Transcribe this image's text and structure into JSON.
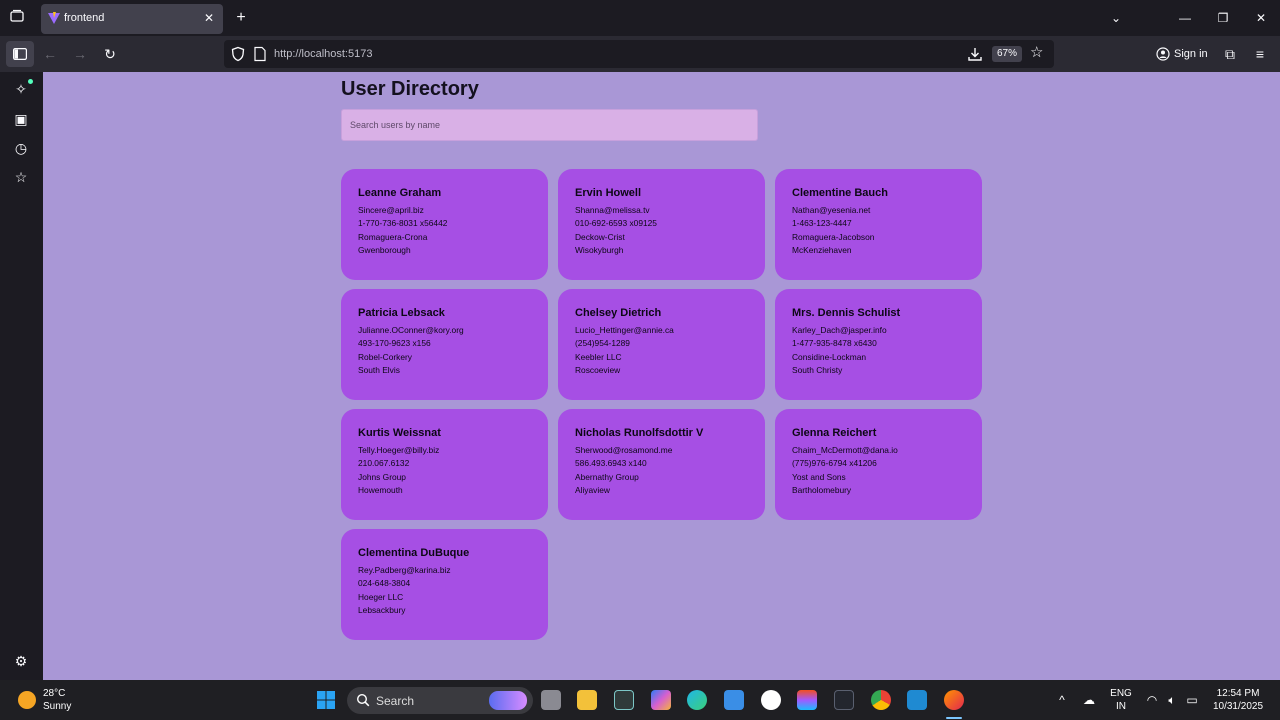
{
  "browser": {
    "tab_title": "frontend",
    "url": "http://localhost:5173",
    "zoom": "67%",
    "sign_in": "Sign in"
  },
  "page": {
    "title": "User Directory",
    "search_placeholder": "Search users by name"
  },
  "users": [
    {
      "name": "Leanne Graham",
      "email": "Sincere@april.biz",
      "phone": "1-770-736-8031 x56442",
      "company": "Romaguera-Crona",
      "city": "Gwenborough"
    },
    {
      "name": "Ervin Howell",
      "email": "Shanna@melissa.tv",
      "phone": "010-692-6593 x09125",
      "company": "Deckow-Crist",
      "city": "Wisokyburgh"
    },
    {
      "name": "Clementine Bauch",
      "email": "Nathan@yesenia.net",
      "phone": "1-463-123-4447",
      "company": "Romaguera-Jacobson",
      "city": "McKenziehaven"
    },
    {
      "name": "Patricia Lebsack",
      "email": "Julianne.OConner@kory.org",
      "phone": "493-170-9623 x156",
      "company": "Robel-Corkery",
      "city": "South Elvis"
    },
    {
      "name": "Chelsey Dietrich",
      "email": "Lucio_Hettinger@annie.ca",
      "phone": "(254)954-1289",
      "company": "Keebler LLC",
      "city": "Roscoeview"
    },
    {
      "name": "Mrs. Dennis Schulist",
      "email": "Karley_Dach@jasper.info",
      "phone": "1-477-935-8478 x6430",
      "company": "Considine-Lockman",
      "city": "South Christy"
    },
    {
      "name": "Kurtis Weissnat",
      "email": "Telly.Hoeger@billy.biz",
      "phone": "210.067.6132",
      "company": "Johns Group",
      "city": "Howemouth"
    },
    {
      "name": "Nicholas Runolfsdottir V",
      "email": "Sherwood@rosamond.me",
      "phone": "586.493.6943 x140",
      "company": "Abernathy Group",
      "city": "Aliyaview"
    },
    {
      "name": "Glenna Reichert",
      "email": "Chaim_McDermott@dana.io",
      "phone": "(775)976-6794 x41206",
      "company": "Yost and Sons",
      "city": "Bartholomebury"
    },
    {
      "name": "Clementina DuBuque",
      "email": "Rey.Padberg@karina.biz",
      "phone": "024-648-3804",
      "company": "Hoeger LLC",
      "city": "Lebsackbury"
    }
  ],
  "taskbar": {
    "weather_temp": "28°C",
    "weather_desc": "Sunny",
    "search_label": "Search",
    "lang_top": "ENG",
    "lang_bottom": "IN",
    "time": "12:54 PM",
    "date": "10/31/2025"
  },
  "colors": {
    "page_bg": "#a997d6",
    "card_bg": "#a64fe4",
    "search_bg": "#d9b0e6"
  }
}
